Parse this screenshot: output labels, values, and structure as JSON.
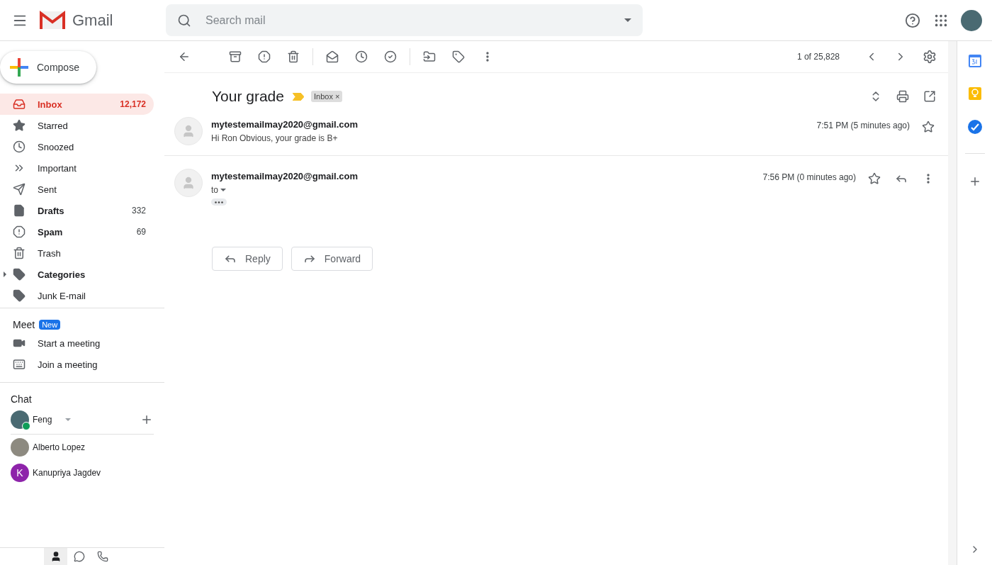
{
  "header": {
    "product_name": "Gmail",
    "search": {
      "placeholder": "Search mail"
    }
  },
  "compose": {
    "label": "Compose"
  },
  "sidebar": {
    "items": [
      {
        "label": "Inbox",
        "count": "12,172",
        "bold": true,
        "selected": true,
        "kind": "inbox"
      },
      {
        "label": "Starred",
        "bold": false,
        "selected": false,
        "kind": "starred"
      },
      {
        "label": "Snoozed",
        "bold": false,
        "selected": false,
        "kind": "snoozed"
      },
      {
        "label": "Important",
        "bold": false,
        "selected": false,
        "kind": "important"
      },
      {
        "label": "Sent",
        "bold": false,
        "selected": false,
        "kind": "sent"
      },
      {
        "label": "Drafts",
        "count": "332",
        "bold": true,
        "selected": false,
        "kind": "drafts"
      },
      {
        "label": "Spam",
        "count": "69",
        "bold": true,
        "selected": false,
        "kind": "spam"
      },
      {
        "label": "Trash",
        "bold": false,
        "selected": false,
        "kind": "trash"
      },
      {
        "label": "Categories",
        "bold": true,
        "selected": false,
        "kind": "categories"
      },
      {
        "label": "Junk E-mail",
        "bold": false,
        "selected": false,
        "kind": "label"
      }
    ]
  },
  "meet": {
    "title": "Meet",
    "badge": "New",
    "items": [
      {
        "label": "Start a meeting",
        "kind": "video"
      },
      {
        "label": "Join a meeting",
        "kind": "keyboard"
      }
    ]
  },
  "chat": {
    "title": "Chat",
    "self": {
      "name": "Feng",
      "online": true
    },
    "contacts": [
      {
        "name": "Alberto Lopez",
        "kind": "photo"
      },
      {
        "name": "Kanupriya Jagdev",
        "kind": "initial",
        "initial": "K",
        "color": "#8e24aa"
      }
    ]
  },
  "chat_tabs": [
    {
      "kind": "people",
      "selected": true
    },
    {
      "kind": "hangouts",
      "selected": false
    },
    {
      "kind": "phone",
      "selected": false
    }
  ],
  "toolbar": {
    "pagination": "1 of 25,828"
  },
  "thread": {
    "subject": "Your grade",
    "important": true,
    "label": "Inbox",
    "label_close": "×",
    "messages": [
      {
        "sender": "mytestemailmay2020@gmail.com",
        "snippet": "Hi Ron Obvious, your grade is B+",
        "time": "7:51 PM (5 minutes ago)",
        "expanded": false,
        "starred": false
      },
      {
        "sender": "mytestemailmay2020@gmail.com",
        "recipient_label": "to",
        "time": "7:56 PM (0 minutes ago)",
        "expanded": true,
        "starred": false
      }
    ]
  },
  "actions": [
    {
      "label": "Reply",
      "kind": "reply"
    },
    {
      "label": "Forward",
      "kind": "forward"
    }
  ]
}
